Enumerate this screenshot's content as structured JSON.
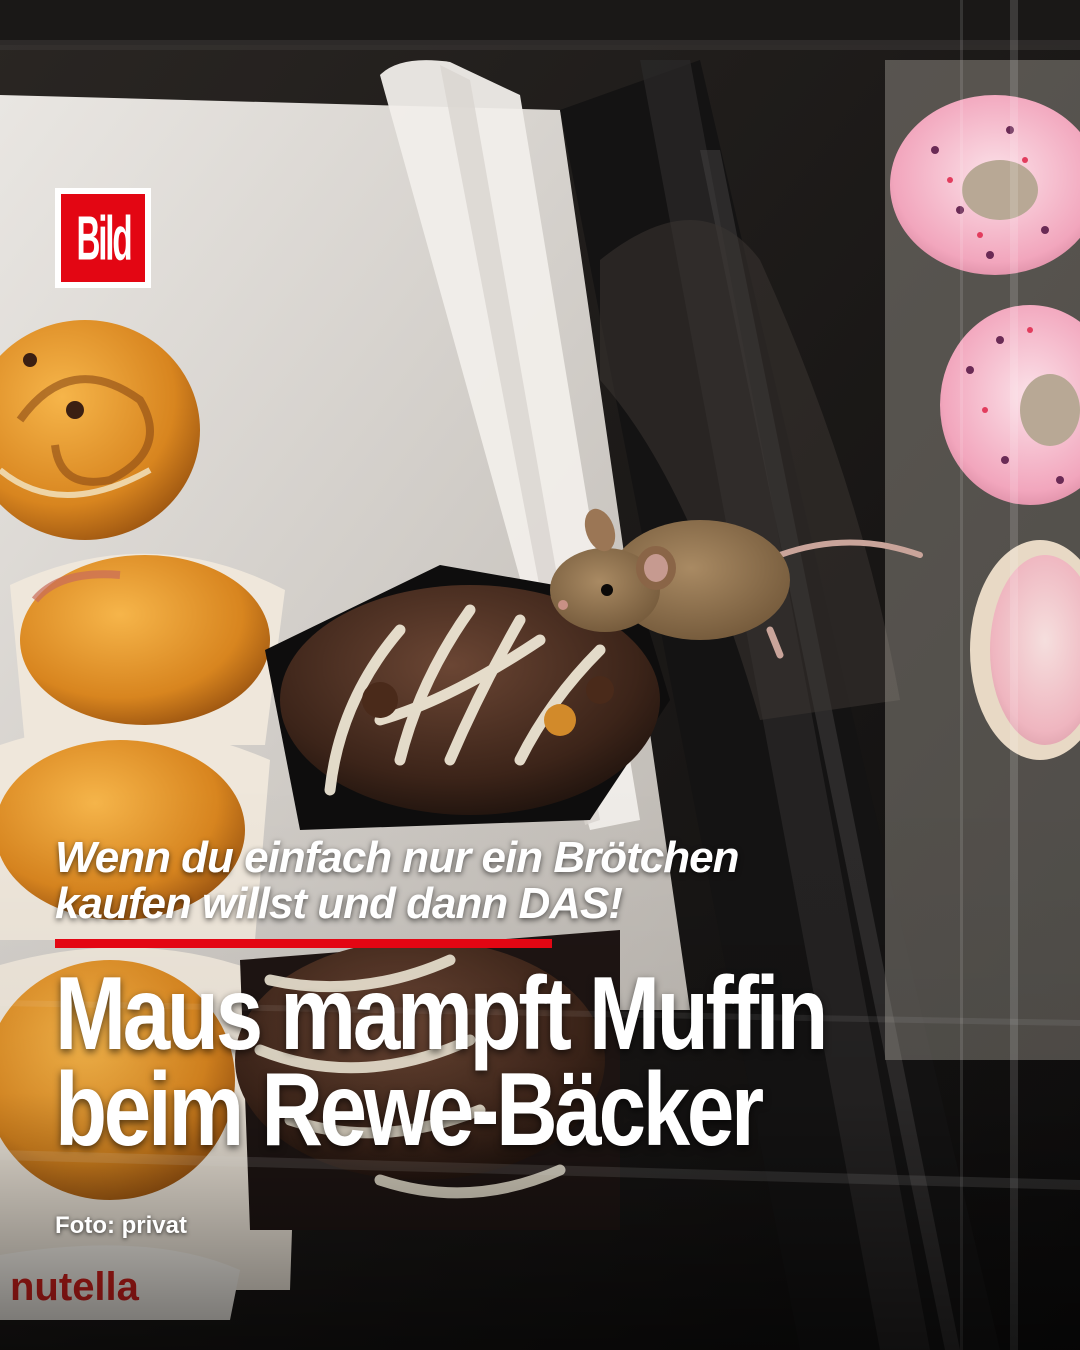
{
  "brand": {
    "logo_text": "Bild",
    "color": "#e30613"
  },
  "post": {
    "kicker_line1": "Wenn du einfach nur ein Brötchen",
    "kicker_line2": "kaufen willst und dann DAS!",
    "headline_line1": "Maus mampft Muffin",
    "headline_line2": "beim Rewe-Bäcker",
    "credit": "Foto: privat"
  },
  "photo": {
    "subject": "mouse-eating-muffin",
    "label_text": "nutella"
  },
  "colors": {
    "accent_red": "#e30613",
    "text": "#ffffff"
  }
}
